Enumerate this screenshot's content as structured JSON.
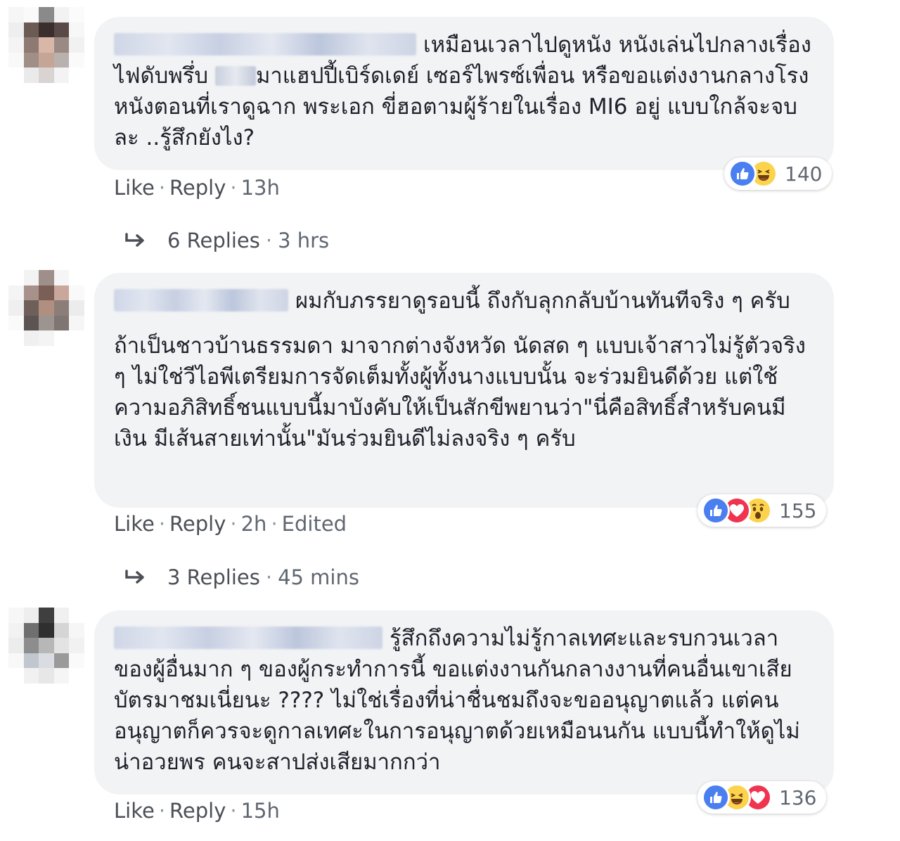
{
  "comments": [
    {
      "text_parts": [
        "เหมือนเวลาไปดูหนัง หนังเล่นไปกลางเรื่อง ไฟดับพรึ่บ ",
        "มาแฮปปี้เบิร์ดเดย์ เซอร์ไพรซ์เพื่อน หรือขอแต่งงานกลางโรงหนังตอนที่เราดูฉาก พระเอก ขี่ฮอตามผู้ร้ายในเรื่อง MI6 อยู่ แบบใกล้จะจบละ ..รู้สึกยังไง?"
      ],
      "reaction_count": "140",
      "reactions": [
        "like-icon",
        "haha-icon"
      ],
      "like": "Like",
      "reply": "Reply",
      "time": "13h",
      "replies_label": "6 Replies",
      "replies_time": "3 hrs"
    },
    {
      "paragraphs": [
        "ผมกับภรรยาดูรอบนี้ ถึงกับลุกกลับบ้านทันทีจริง ๆ ครับ",
        "ถ้าเป็นชาวบ้านธรรมดา มาจากต่างจังหวัด นัดสด ๆ แบบเจ้าสาวไม่รู้ตัวจริง ๆ ไม่ใช่วีไอพีเตรียมการจัดเต็มทั้งผู้ทั้งนางแบบนั้น จะร่วมยินดีด้วย แต่ใช้ความอภิสิทธิ์ชนแบบนี้มาบังคับให้เป็นสักขีพยานว่า\"นี่คือสิทธิ์สำหรับคนมีเงิน มีเส้นสายเท่านั้น\"มันร่วมยินดีไม่ลงจริง ๆ ครับ"
      ],
      "reaction_count": "155",
      "reactions": [
        "like-icon",
        "love-icon",
        "wow-icon"
      ],
      "like": "Like",
      "reply": "Reply",
      "time": "2h",
      "edited": "Edited",
      "replies_label": "3 Replies",
      "replies_time": "45 mins"
    },
    {
      "text": "รู้สึกถึงความไม่รู้กาลเทศะและรบกวนเวลาของผู้อื่นมาก ๆ ของผู้กระทำการนี้ ขอแต่งงานกันกลางงานที่คนอื่นเขาเสียบัตรมาชมเนี่ยนะ ???? ไม่ใช่เรื่องที่น่าชื่นชมถึงจะขออนุญาตแล้ว แต่คนอนุญาตก็ควรจะดูกาลเทศะในการอนุญาตด้วยเหมือนนกัน แบบนี้ทำให้ดูไม่น่าอวยพร คนจะสาปส่งเสียมากกว่า",
      "reaction_count": "136",
      "reactions": [
        "like-icon",
        "haha-icon",
        "love-icon"
      ],
      "like": "Like",
      "reply": "Reply",
      "time": "15h"
    }
  ],
  "separator": "·"
}
